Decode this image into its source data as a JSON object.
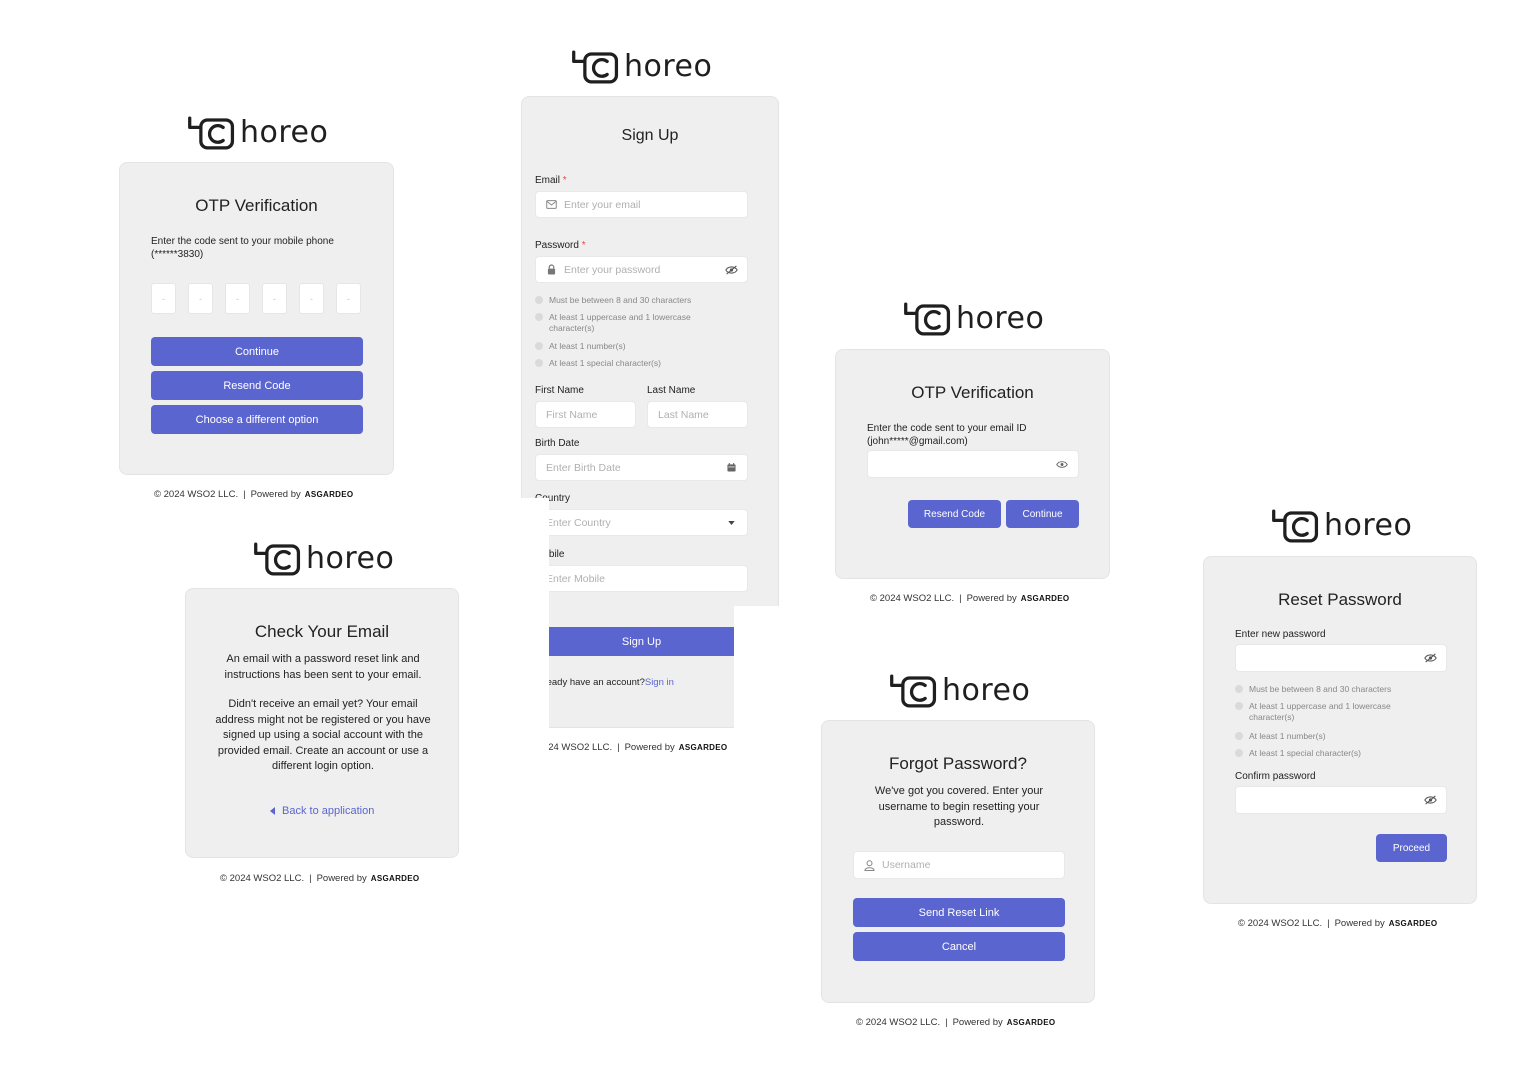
{
  "brand": {
    "logo_text": "horeo"
  },
  "footer": {
    "copyright": "© 2024 WSO2 LLC.",
    "separator": "|",
    "powered": "Powered by",
    "brand": "ASGARDEO"
  },
  "otp_mobile": {
    "title": "OTP Verification",
    "instruction": "Enter the code sent to your mobile phone (******3830)",
    "box_char": "-",
    "continue": "Continue",
    "resend": "Resend Code",
    "different": "Choose a different option"
  },
  "check_email": {
    "title": "Check Your Email",
    "line1": "An email with a password reset link and instructions has been sent to your email.",
    "line2": "Didn't receive an email yet? Your email address might not be registered or you have signed up using a social account with the provided email. Create an account or use a different login option.",
    "back": "Back to application"
  },
  "signup": {
    "title": "Sign Up",
    "email_label": "Email",
    "email_placeholder": "Enter your email",
    "password_label": "Password",
    "password_placeholder": "Enter your password",
    "required_mark": "*",
    "rules": [
      "Must be between 8 and 30 characters",
      "At least 1 uppercase and 1 lowercase character(s)",
      "At least 1 number(s)",
      "At least 1 special character(s)"
    ],
    "first_name_label": "First Name",
    "first_name_placeholder": "First Name",
    "last_name_label": "Last Name",
    "last_name_placeholder": "Last Name",
    "birth_label": "Birth Date",
    "birth_placeholder": "Enter Birth Date",
    "country_label": "Country",
    "country_placeholder": "Enter Country",
    "mobile_label": "Mobile",
    "mobile_placeholder": "Enter Mobile",
    "submit": "Sign Up",
    "have_account": "Already have an account?",
    "signin": "Sign in"
  },
  "otp_email": {
    "title": "OTP Verification",
    "instruction": "Enter the code sent to your email ID (john*****@gmail.com)",
    "resend": "Resend Code",
    "continue": "Continue"
  },
  "forgot": {
    "title": "Forgot Password?",
    "text": "We've got you covered. Enter your username to begin resetting your password.",
    "username_placeholder": "Username",
    "send": "Send Reset Link",
    "cancel": "Cancel"
  },
  "reset": {
    "title": "Reset Password",
    "new_label": "Enter new password",
    "confirm_label": "Confirm password",
    "rules": [
      "Must be between 8 and 30 characters",
      "At least 1 uppercase and 1 lowercase character(s)",
      "At least 1 number(s)",
      "At least 1 special character(s)"
    ],
    "proceed": "Proceed"
  },
  "colors": {
    "accent": "#5b65d0",
    "card": "#efefef",
    "required": "#e64545"
  }
}
